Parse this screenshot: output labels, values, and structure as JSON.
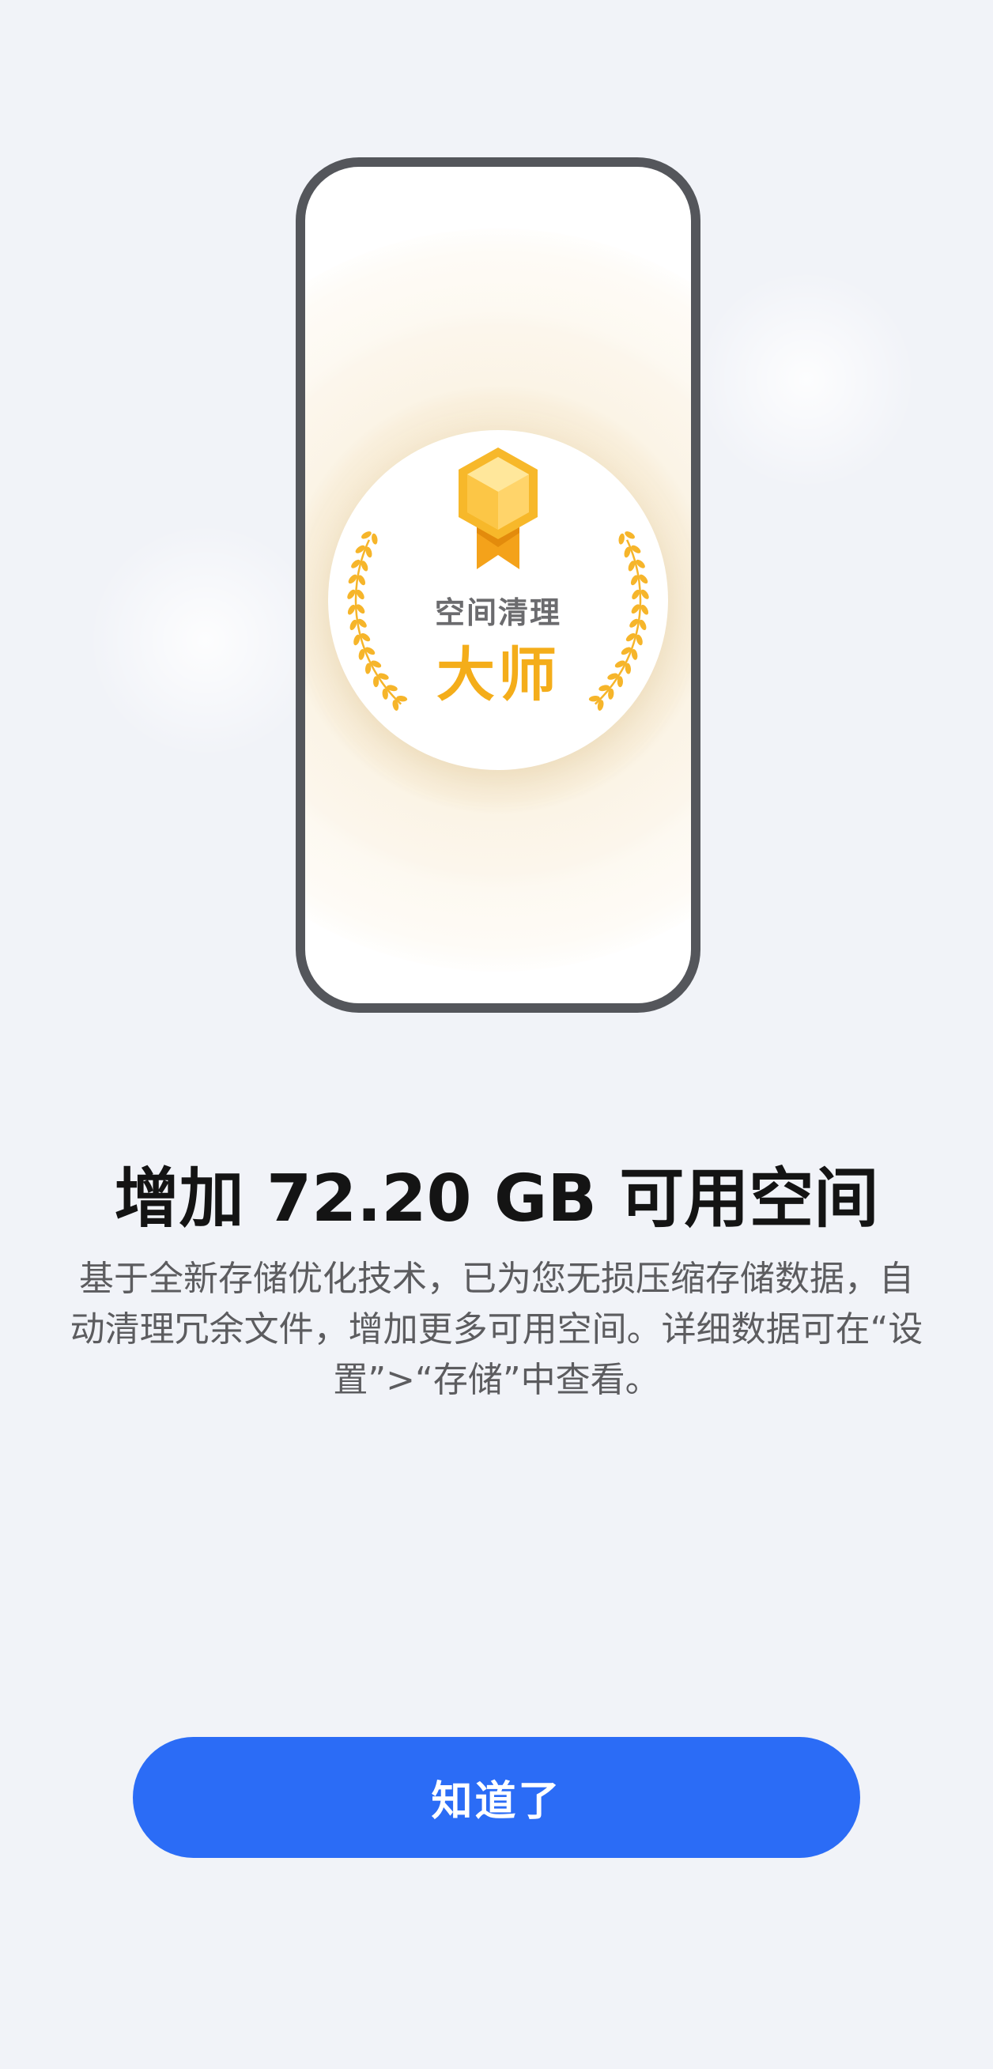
{
  "badge": {
    "subtitle": "空间清理",
    "title": "大师",
    "medal_icon": "medal-icon",
    "laurel_icon": "laurel-wreath-icon"
  },
  "headline": "增加 72.20 GB 可用空间",
  "description": "基于全新存储优化技术，已为您无损压缩存储数据，自动清理冗余文件，增加更多可用空间。详细数据可在“设置”>“存储”中查看。",
  "ok_button_label": "知道了",
  "colors": {
    "accent": "#2b6cf6",
    "gold": "#f4ad1a",
    "background": "#f1f3f8",
    "phone_frame": "#54565b"
  }
}
